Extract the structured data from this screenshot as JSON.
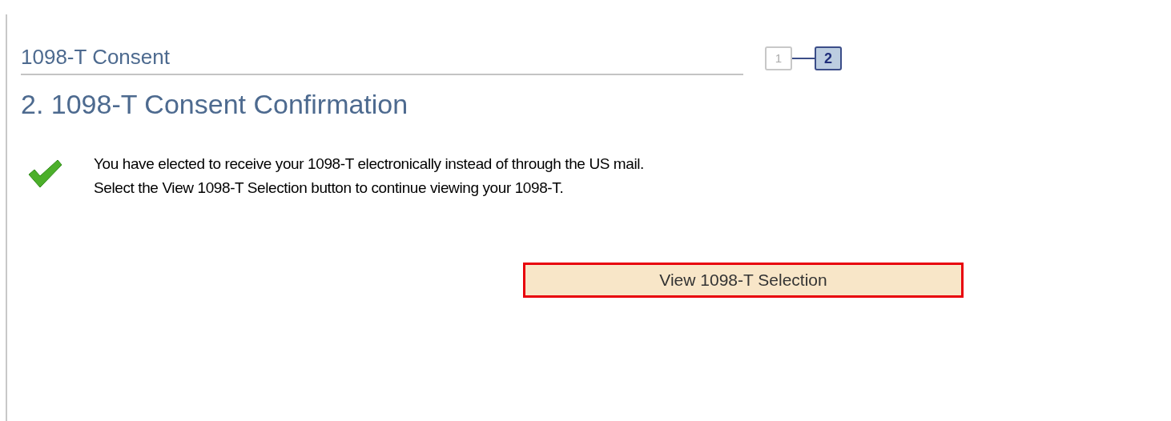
{
  "header": {
    "title": "1098-T Consent"
  },
  "steps": [
    {
      "label": "1",
      "selected": false
    },
    {
      "label": "2",
      "selected": true
    }
  ],
  "heading": "2. 1098-T Consent Confirmation",
  "message": {
    "lines": [
      "You have elected to receive your 1098-T electronically instead of through the US mail.",
      "Select the View 1098-T Selection button to continue viewing your 1098-T."
    ]
  },
  "button": {
    "label": "View 1098-T Selection",
    "highlighted": true
  }
}
